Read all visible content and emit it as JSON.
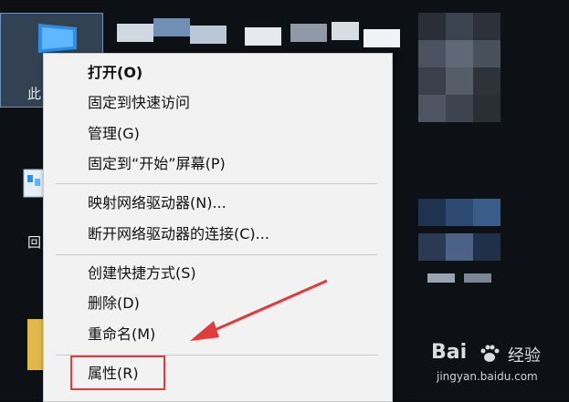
{
  "desktop": {
    "this_pc_label": "此",
    "recycle_label": "回"
  },
  "context_menu": {
    "items": [
      {
        "label": "打开(O)",
        "bold": true
      },
      {
        "label": "固定到快速访问"
      },
      {
        "label": "管理(G)"
      },
      {
        "label": "固定到“开始”屏幕(P)"
      },
      {
        "label": "映射网络驱动器(N)..."
      },
      {
        "label": "断开网络驱动器的连接(C)..."
      },
      {
        "label": "创建快捷方式(S)"
      },
      {
        "label": "删除(D)"
      },
      {
        "label": "重命名(M)"
      },
      {
        "label": "属性(R)"
      }
    ]
  },
  "annotation": {
    "highlight_color": "#e23b3b",
    "arrow_color": "#e23b3b"
  },
  "watermark": {
    "brand": "Bai",
    "site_name": "经验",
    "url": "jingyan.baidu.com"
  }
}
